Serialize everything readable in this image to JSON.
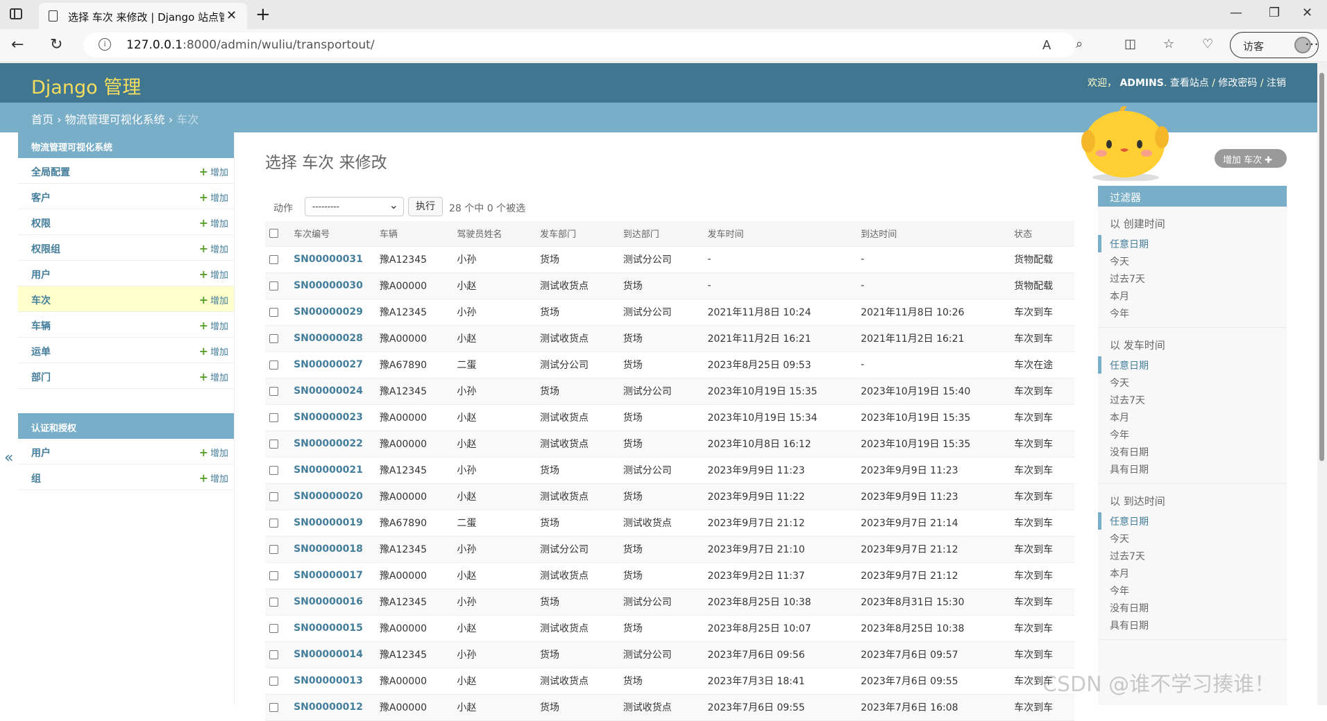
{
  "browser": {
    "tab_title": "选择 车次 来修改 | Django 站点管理",
    "url_host": "127.0.0.1",
    "url_rest": ":8000/admin/wuliu/transportout/",
    "guest_label": "访客"
  },
  "header": {
    "branding": "Django 管理",
    "welcome": "欢迎，",
    "user": "ADMINS",
    "view_site": "查看站点",
    "change_password": "修改密码",
    "logout": "注销"
  },
  "breadcrumbs": {
    "home": "首页",
    "app": "物流管理可视化系统",
    "current": "车次"
  },
  "sidebar": {
    "module1_caption": "物流管理可视化系统",
    "module1_items": [
      {
        "label": "全局配置",
        "add": "增加"
      },
      {
        "label": "客户",
        "add": "增加"
      },
      {
        "label": "权限",
        "add": "增加"
      },
      {
        "label": "权限组",
        "add": "增加"
      },
      {
        "label": "用户",
        "add": "增加"
      },
      {
        "label": "车次",
        "add": "增加"
      },
      {
        "label": "车辆",
        "add": "增加"
      },
      {
        "label": "运单",
        "add": "增加"
      },
      {
        "label": "部门",
        "add": "增加"
      }
    ],
    "module2_caption": "认证和授权",
    "module2_items": [
      {
        "label": "用户",
        "add": "增加"
      },
      {
        "label": "组",
        "add": "增加"
      }
    ],
    "toggle": "«"
  },
  "content": {
    "title": "选择 车次 来修改",
    "add_button": "增加 车次",
    "actions": {
      "label": "动作",
      "select_value": "---------",
      "go": "执行",
      "counter": "28 个中 0 个被选"
    },
    "columns": [
      "车次编号",
      "车辆",
      "驾驶员姓名",
      "发车部门",
      "到达部门",
      "发车时间",
      "到达时间",
      "状态"
    ],
    "rows": [
      [
        "SN00000031",
        "豫A12345",
        "小孙",
        "货场",
        "测试分公司",
        "-",
        "-",
        "货物配载"
      ],
      [
        "SN00000030",
        "豫A00000",
        "小赵",
        "测试收货点",
        "货场",
        "-",
        "-",
        "货物配载"
      ],
      [
        "SN00000029",
        "豫A12345",
        "小孙",
        "货场",
        "测试分公司",
        "2021年11月8日 10:24",
        "2021年11月8日 10:26",
        "车次到车"
      ],
      [
        "SN00000028",
        "豫A00000",
        "小赵",
        "测试收货点",
        "货场",
        "2021年11月2日 16:21",
        "2021年11月2日 16:21",
        "车次到车"
      ],
      [
        "SN00000027",
        "豫A67890",
        "二蛋",
        "测试分公司",
        "货场",
        "2023年8月25日 09:53",
        "-",
        "车次在途"
      ],
      [
        "SN00000024",
        "豫A12345",
        "小孙",
        "货场",
        "测试分公司",
        "2023年10月19日 15:35",
        "2023年10月19日 15:40",
        "车次到车"
      ],
      [
        "SN00000023",
        "豫A00000",
        "小赵",
        "测试收货点",
        "货场",
        "2023年10月19日 15:34",
        "2023年10月19日 15:35",
        "车次到车"
      ],
      [
        "SN00000022",
        "豫A00000",
        "小赵",
        "测试收货点",
        "货场",
        "2023年10月8日 16:12",
        "2023年10月19日 15:35",
        "车次到车"
      ],
      [
        "SN00000021",
        "豫A12345",
        "小孙",
        "货场",
        "测试分公司",
        "2023年9月9日 11:23",
        "2023年9月9日 11:23",
        "车次到车"
      ],
      [
        "SN00000020",
        "豫A00000",
        "小赵",
        "测试收货点",
        "货场",
        "2023年9月9日 11:22",
        "2023年9月9日 11:23",
        "车次到车"
      ],
      [
        "SN00000019",
        "豫A67890",
        "二蛋",
        "货场",
        "测试收货点",
        "2023年9月7日 21:12",
        "2023年9月7日 21:14",
        "车次到车"
      ],
      [
        "SN00000018",
        "豫A12345",
        "小孙",
        "测试分公司",
        "货场",
        "2023年9月7日 21:10",
        "2023年9月7日 21:12",
        "车次到车"
      ],
      [
        "SN00000017",
        "豫A00000",
        "小赵",
        "测试收货点",
        "货场",
        "2023年9月2日 11:37",
        "2023年9月7日 21:12",
        "车次到车"
      ],
      [
        "SN00000016",
        "豫A12345",
        "小孙",
        "货场",
        "测试分公司",
        "2023年8月25日 10:38",
        "2023年8月31日 15:30",
        "车次到车"
      ],
      [
        "SN00000015",
        "豫A00000",
        "小赵",
        "测试收货点",
        "货场",
        "2023年8月25日 10:07",
        "2023年8月25日 10:38",
        "车次到车"
      ],
      [
        "SN00000014",
        "豫A12345",
        "小孙",
        "货场",
        "测试分公司",
        "2023年7月6日 09:56",
        "2023年7月6日 09:57",
        "车次到车"
      ],
      [
        "SN00000013",
        "豫A00000",
        "小赵",
        "测试收货点",
        "货场",
        "2023年7月3日 18:41",
        "2023年7月6日 09:55",
        "车次到车"
      ],
      [
        "SN00000012",
        "豫A00000",
        "小赵",
        "货场",
        "测试收货点",
        "2023年7月6日 09:55",
        "2023年7月6日 16:08",
        "车次到车"
      ]
    ]
  },
  "filter": {
    "title": "过滤器",
    "groups": [
      {
        "title": "以 创建时间",
        "options": [
          "任意日期",
          "今天",
          "过去7天",
          "本月",
          "今年"
        ]
      },
      {
        "title": "以 发车时间",
        "options": [
          "任意日期",
          "今天",
          "过去7天",
          "本月",
          "今年",
          "没有日期",
          "具有日期"
        ]
      },
      {
        "title": "以 到达时间",
        "options": [
          "任意日期",
          "今天",
          "过去7天",
          "本月",
          "今年",
          "没有日期",
          "具有日期"
        ]
      }
    ]
  },
  "watermark": "CSDN @谁不学习揍谁！",
  "colors": {
    "header": "#417690",
    "breadcrumb": "#79aec8",
    "branding": "#f5dd5d",
    "link": "#447e9b",
    "current_row": "#ffffcc"
  }
}
